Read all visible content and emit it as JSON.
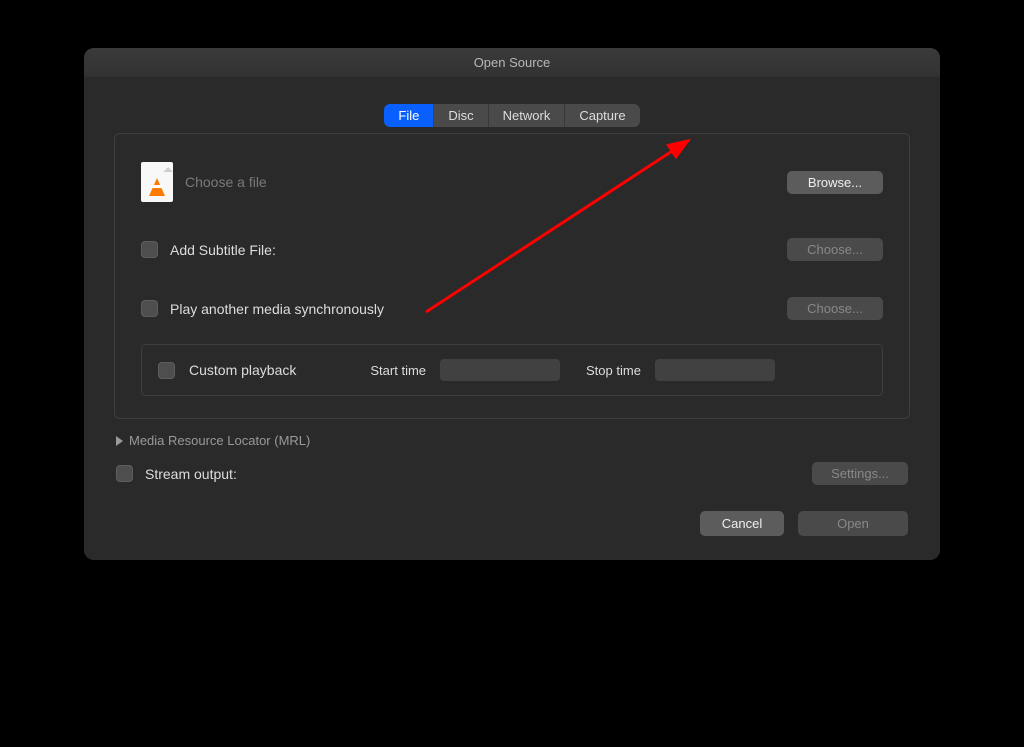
{
  "title": "Open Source",
  "tabs": [
    {
      "label": "File",
      "active": true
    },
    {
      "label": "Disc",
      "active": false
    },
    {
      "label": "Network",
      "active": false
    },
    {
      "label": "Capture",
      "active": false
    }
  ],
  "choose_file_placeholder": "Choose a file",
  "browse_button": "Browse...",
  "subtitle": {
    "label": "Add Subtitle File:",
    "button": "Choose..."
  },
  "sync_media": {
    "label": "Play another media synchronously",
    "button": "Choose..."
  },
  "custom_playback": {
    "label": "Custom playback",
    "start_label": "Start time",
    "stop_label": "Stop time",
    "start_value": "",
    "stop_value": ""
  },
  "mrl_label": "Media Resource Locator (MRL)",
  "stream_output": {
    "label": "Stream output:",
    "button": "Settings..."
  },
  "footer": {
    "cancel": "Cancel",
    "open": "Open"
  }
}
